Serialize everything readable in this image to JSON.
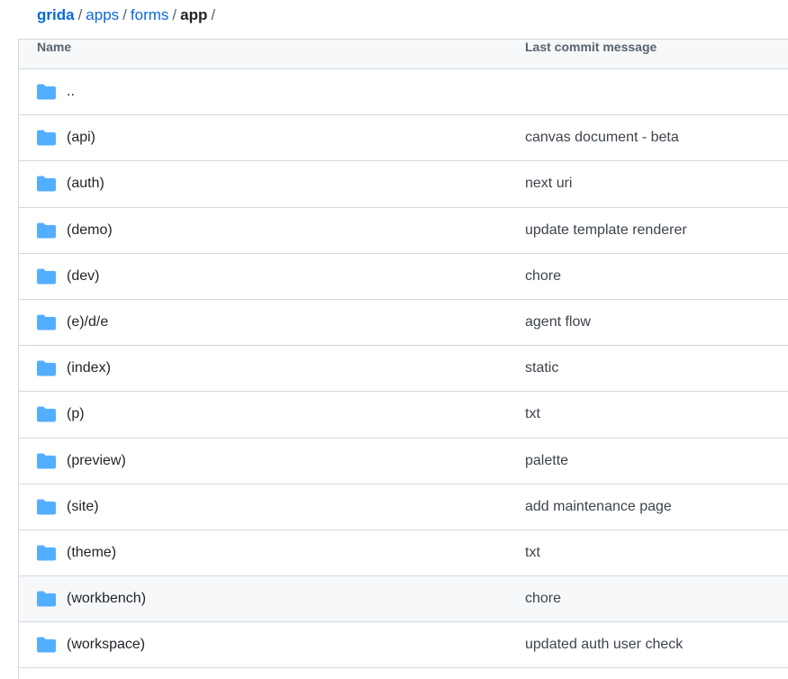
{
  "breadcrumb": {
    "segments": [
      "grida",
      "apps",
      "forms"
    ],
    "current": "app",
    "separator": "/"
  },
  "table": {
    "headers": {
      "name": "Name",
      "last_commit_message": "Last commit message"
    },
    "rows": [
      {
        "name": "..",
        "message": ""
      },
      {
        "name": "(api)",
        "message": "canvas document - beta"
      },
      {
        "name": "(auth)",
        "message": "next uri"
      },
      {
        "name": "(demo)",
        "message": "update template renderer"
      },
      {
        "name": "(dev)",
        "message": "chore"
      },
      {
        "name": "(e)/d/e",
        "message": "agent flow"
      },
      {
        "name": "(index)",
        "message": "static"
      },
      {
        "name": "(p)",
        "message": "txt"
      },
      {
        "name": "(preview)",
        "message": "palette"
      },
      {
        "name": "(site)",
        "message": "add maintenance page"
      },
      {
        "name": "(theme)",
        "message": "txt"
      },
      {
        "name": "(workbench)",
        "message": "chore"
      },
      {
        "name": "(workspace)",
        "message": "updated auth user check"
      }
    ]
  },
  "icons": {
    "folder": "folder-icon"
  },
  "colors": {
    "link": "#0969da",
    "folder": "#54aeff",
    "border": "#d1d9e0",
    "header_bg": "#f6f8fa"
  }
}
